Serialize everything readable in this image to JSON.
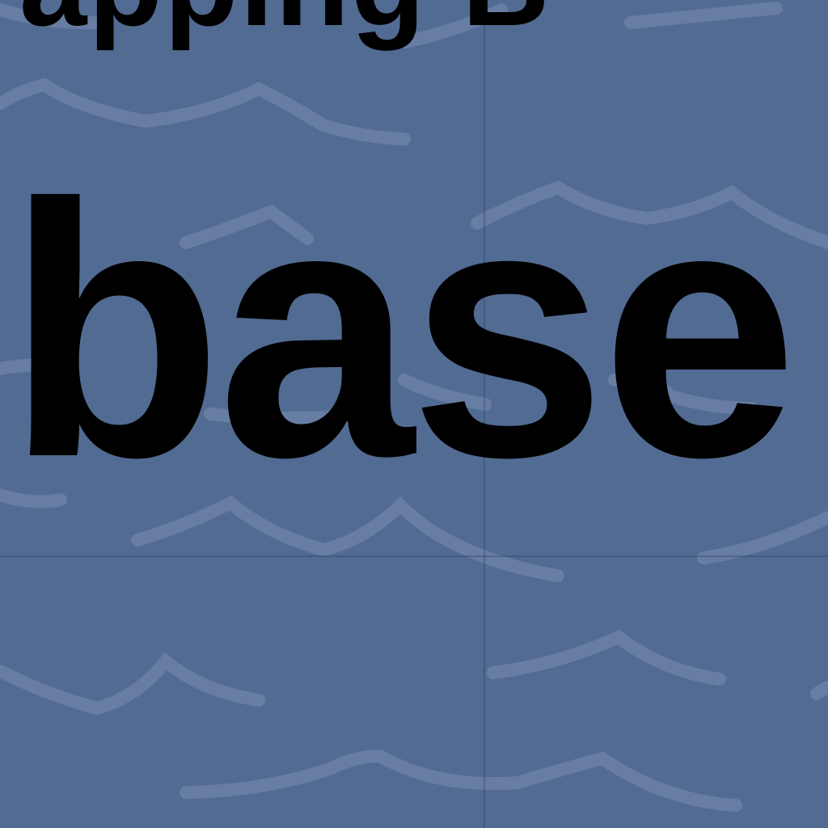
{
  "map": {
    "water_color": "#526b93",
    "wave_color": "#6a80a5",
    "label_color": "#000000",
    "labels": {
      "partial_top": "apping B",
      "main": "base"
    }
  }
}
